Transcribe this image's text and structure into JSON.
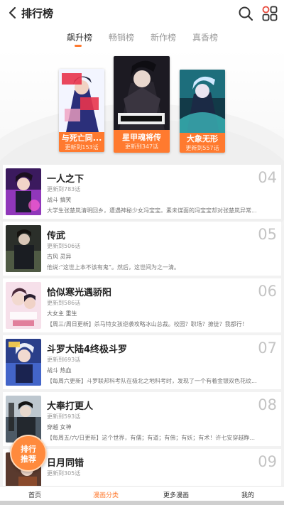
{
  "header": {
    "title": "排行榜",
    "back_icon": "chevron-left-icon",
    "search_icon": "search-icon",
    "menu_icon": "grid-icon"
  },
  "tabs": [
    {
      "label": "飙升榜",
      "active": true
    },
    {
      "label": "畅销榜",
      "active": false
    },
    {
      "label": "新作榜",
      "active": false
    },
    {
      "label": "真香榜",
      "active": false
    }
  ],
  "podium": [
    {
      "rank": 2,
      "title": "与死亡同...",
      "update": "更新到153话"
    },
    {
      "rank": 1,
      "title": "星甲魂将传",
      "update": "更新到347话"
    },
    {
      "rank": 3,
      "title": "大象无形",
      "update": "更新到557话"
    }
  ],
  "list": [
    {
      "title": "一人之下",
      "update": "更新到783话",
      "tags": "战斗 搞笑",
      "desc": "大学生张楚岚清明回乡，遭遇神秘少女冯宝宝。素未谋面的冯宝宝却对张楚岚异常...",
      "rank": "04"
    },
    {
      "title": "传武",
      "update": "更新到506话",
      "tags": "古风 灵异",
      "desc": "他说:“这世上本不该有鬼”。然后，这世间为之一清。",
      "rank": "05"
    },
    {
      "title": "恰似寒光遇骄阳",
      "update": "更新到586话",
      "tags": "大女主 重生",
      "desc": "【周三/周日更新】杀马特女孩逆袭攻略冰山总裁。校园？职场？撩徒？我都行！",
      "rank": "06"
    },
    {
      "title": "斗罗大陆4终极斗罗",
      "update": "更新到693话",
      "tags": "战斗 热血",
      "desc": "【每周六更新】斗罗联邦科考队在极北之地科考时，发现了一个有着金银双色花纹...",
      "rank": "07"
    },
    {
      "title": "大奉打更人",
      "update": "更新到593话",
      "tags": "穿越 女神",
      "desc": "【每周五/六/日更新】这个世界，有儒；有道；有佛；有妖；有术！许七安穿越睁...",
      "rank": "08"
    },
    {
      "title": "日月同错",
      "update": "更新到305话",
      "tags": "",
      "desc": "",
      "rank": "09"
    }
  ],
  "badge": {
    "line1": "排行",
    "line2": "推荐"
  },
  "bottom_nav": [
    {
      "label": "首页",
      "active": false
    },
    {
      "label": "漫画分类",
      "active": true
    },
    {
      "label": "更多漫画",
      "active": false
    },
    {
      "label": "我的",
      "active": false
    }
  ],
  "colors": {
    "accent": "#ff7a2f",
    "rank_gray": "#c4c4c4"
  }
}
